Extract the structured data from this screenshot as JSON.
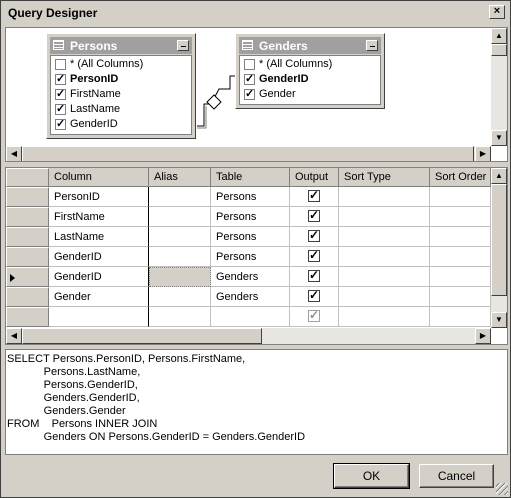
{
  "window": {
    "title": "Query Designer",
    "close_glyph": "×"
  },
  "diagram": {
    "persons": {
      "name": "Persons",
      "columns": [
        {
          "label": "* (All Columns)",
          "checked": false,
          "bold": false
        },
        {
          "label": "PersonID",
          "checked": true,
          "bold": true
        },
        {
          "label": "FirstName",
          "checked": true,
          "bold": false
        },
        {
          "label": "LastName",
          "checked": true,
          "bold": false
        },
        {
          "label": "GenderID",
          "checked": true,
          "bold": false
        }
      ]
    },
    "genders": {
      "name": "Genders",
      "columns": [
        {
          "label": "* (All Columns)",
          "checked": false,
          "bold": false
        },
        {
          "label": "GenderID",
          "checked": true,
          "bold": true
        },
        {
          "label": "Gender",
          "checked": true,
          "bold": false
        }
      ]
    }
  },
  "grid": {
    "headers": [
      "Column",
      "Alias",
      "Table",
      "Output",
      "Sort Type",
      "Sort Order"
    ],
    "rows": [
      {
        "column": "PersonID",
        "alias": "",
        "table": "Persons",
        "output": true
      },
      {
        "column": "FirstName",
        "alias": "",
        "table": "Persons",
        "output": true
      },
      {
        "column": "LastName",
        "alias": "",
        "table": "Persons",
        "output": true
      },
      {
        "column": "GenderID",
        "alias": "",
        "table": "Persons",
        "output": true
      },
      {
        "column": "GenderID",
        "alias": "",
        "table": "Genders",
        "output": true,
        "current": true
      },
      {
        "column": "Gender",
        "alias": "",
        "table": "Genders",
        "output": true
      },
      {
        "column": "",
        "alias": "",
        "table": "",
        "output": true,
        "placeholder": true
      }
    ]
  },
  "sql": {
    "lines": [
      "SELECT Persons.PersonID, Persons.FirstName,",
      "            Persons.LastName,",
      "            Persons.GenderID,",
      "            Genders.GenderID,",
      "            Genders.Gender",
      "FROM    Persons INNER JOIN",
      "            Genders ON Persons.GenderID = Genders.GenderID"
    ]
  },
  "buttons": {
    "ok": "OK",
    "cancel": "Cancel"
  }
}
